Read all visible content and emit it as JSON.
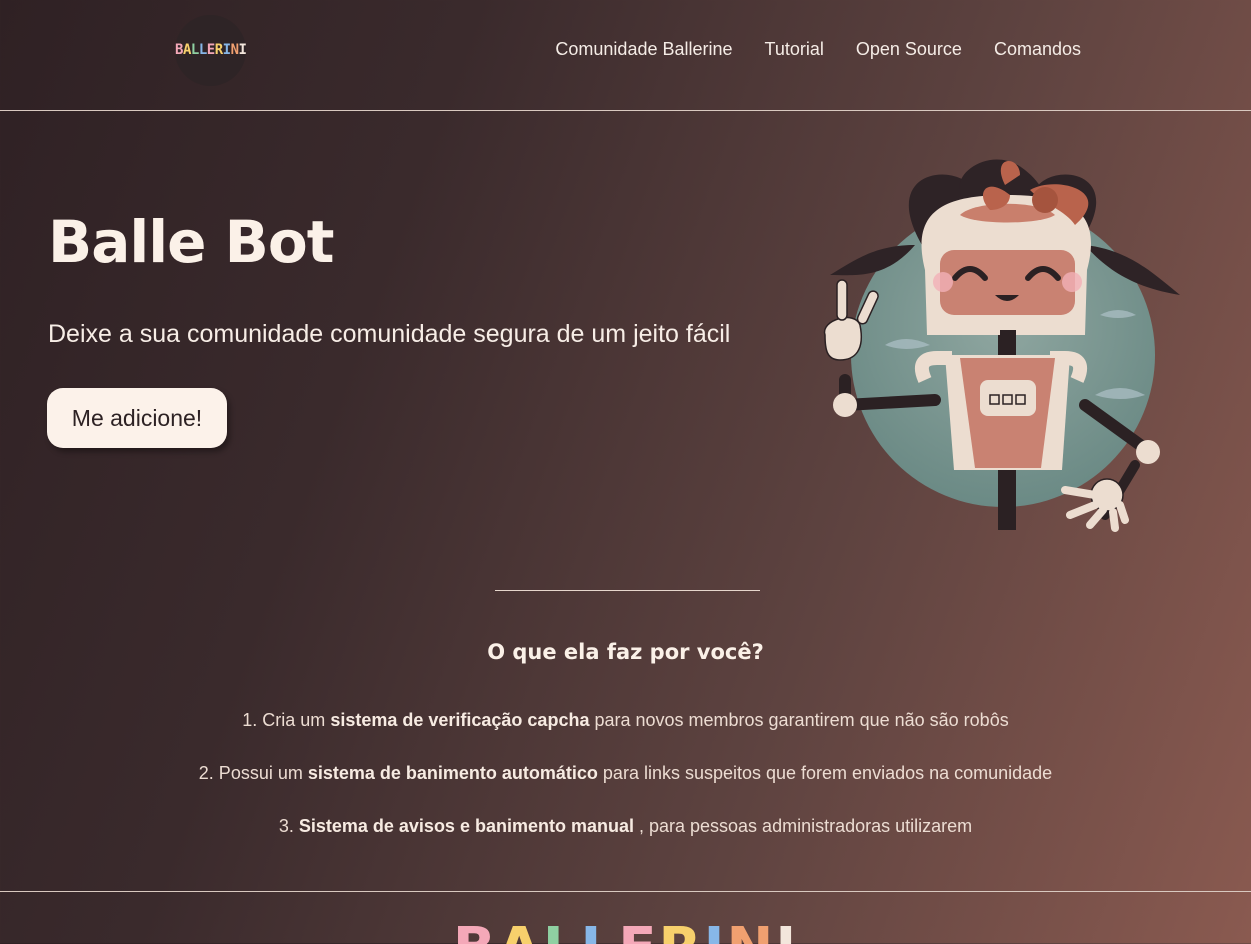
{
  "nav": {
    "logo_text": [
      "B",
      "A",
      "L",
      "L",
      "E",
      "R",
      "I",
      "N",
      "I"
    ],
    "links": [
      {
        "label": "Comunidade Ballerine"
      },
      {
        "label": "Tutorial"
      },
      {
        "label": "Open Source"
      },
      {
        "label": "Comandos"
      }
    ]
  },
  "hero": {
    "title": "Balle Bot",
    "subtitle": "Deixe a sua comunidade comunidade segura de um jeito fácil",
    "cta_label": "Me adicione!",
    "illustration": "robot-girl-illustration"
  },
  "features": {
    "title": "O que ela faz por você?",
    "items": [
      {
        "prefix": "1. Cria um ",
        "bold": "sistema de verificação capcha",
        "suffix": " para novos membros garantirem que não são robôs"
      },
      {
        "prefix": "2. Possui um ",
        "bold": "sistema de banimento automático",
        "suffix": " para links suspeitos que forem enviados na comunidade"
      },
      {
        "prefix": "3. ",
        "bold": "Sistema de avisos e banimento manual",
        "suffix": " , para pessoas administradoras utilizarem"
      }
    ]
  },
  "footer": {
    "logo_text": [
      "B",
      "A",
      "L",
      "L",
      "E",
      "R",
      "I",
      "N",
      "I"
    ]
  },
  "colors": {
    "background_start": "#2f2124",
    "background_end": "#8a5a50",
    "text": "#fbf1e8",
    "button_bg": "#fcf2ea"
  }
}
